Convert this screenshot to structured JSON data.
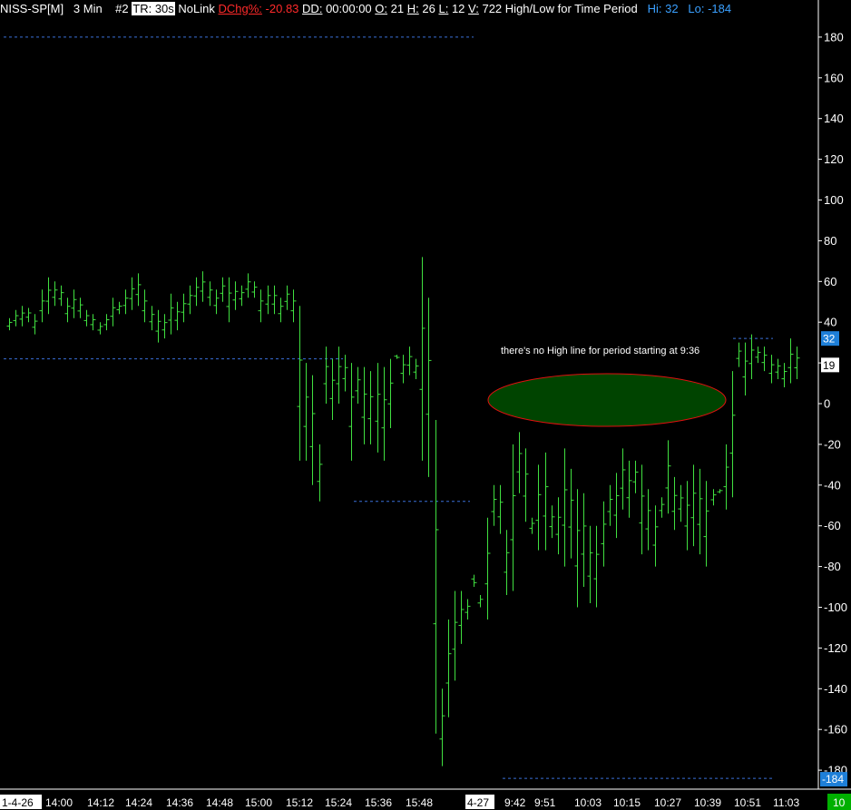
{
  "header": {
    "symbol": "NISS-SP[M]",
    "interval": "3 Min",
    "chart_number": "#2",
    "tr_label": "TR: 30s",
    "link_status": "NoLink",
    "dchg_label": "DChg%:",
    "dchg_value": "-20.83",
    "dd_label": "DD:",
    "dd_value": "00:00:00",
    "o_label": "O:",
    "o_value": "21",
    "h_label": "H:",
    "h_value": "26",
    "l_label": "L:",
    "l_value": "12",
    "v_label": "V:",
    "v_value": "722",
    "study_name": "High/Low for Time Period",
    "hi_text": "Hi: 32",
    "lo_text": "Lo: -184"
  },
  "colors": {
    "background": "#000000",
    "bars": "#40e040",
    "hl_lines": "#3a6fd8",
    "ellipse_fill": "#004400",
    "ellipse_stroke": "#e01010",
    "axis_text": "#ffffff",
    "blue_label_bg": "#1e7fd8",
    "last_price_bg": "#00b000"
  },
  "chart_data": {
    "type": "ohlc",
    "title": "",
    "annotation": "there's no High line for period starting at 9:36",
    "ylim": [
      -190,
      192
    ],
    "y_ticks": [
      180,
      160,
      140,
      120,
      100,
      80,
      60,
      40,
      20,
      0,
      -20,
      -40,
      -60,
      -80,
      -100,
      -120,
      -140,
      -160,
      -180
    ],
    "price_labels": {
      "high": "32",
      "last": "19",
      "low": "-184"
    },
    "x_labels": [
      "1-4-26",
      "14:00",
      "14:12",
      "14:24",
      "14:36",
      "14:48",
      "15:00",
      "15:12",
      "15:24",
      "15:36",
      "15:48",
      "4-27",
      "9:42",
      "9:51",
      "10:03",
      "10:15",
      "10:27",
      "10:39",
      "10:51",
      "11:03"
    ],
    "last_time_label": "10",
    "session_high_low_lines": [
      {
        "session": "1-4-26",
        "high": 180,
        "low": 22
      },
      {
        "session": "1-4-26 close",
        "low": -48
      },
      {
        "session": "4-27",
        "high": 32,
        "low": -184
      }
    ],
    "bars": [
      [
        42,
        36
      ],
      [
        46,
        38
      ],
      [
        48,
        38
      ],
      [
        47,
        40
      ],
      [
        44,
        34
      ],
      [
        56,
        40
      ],
      [
        62,
        44
      ],
      [
        60,
        48
      ],
      [
        58,
        48
      ],
      [
        52,
        40
      ],
      [
        56,
        42
      ],
      [
        52,
        42
      ],
      [
        46,
        38
      ],
      [
        44,
        36
      ],
      [
        40,
        34
      ],
      [
        44,
        36
      ],
      [
        52,
        38
      ],
      [
        50,
        44
      ],
      [
        56,
        44
      ],
      [
        62,
        46
      ],
      [
        64,
        48
      ],
      [
        56,
        40
      ],
      [
        48,
        36
      ],
      [
        46,
        30
      ],
      [
        44,
        32
      ],
      [
        54,
        34
      ],
      [
        50,
        36
      ],
      [
        54,
        40
      ],
      [
        58,
        44
      ],
      [
        62,
        48
      ],
      [
        65,
        50
      ],
      [
        60,
        48
      ],
      [
        56,
        44
      ],
      [
        62,
        50
      ],
      [
        62,
        40
      ],
      [
        60,
        46
      ],
      [
        58,
        48
      ],
      [
        64,
        52
      ],
      [
        60,
        52
      ],
      [
        56,
        40
      ],
      [
        58,
        44
      ],
      [
        58,
        44
      ],
      [
        52,
        40
      ],
      [
        58,
        46
      ],
      [
        56,
        40
      ],
      [
        48,
        -28
      ],
      [
        20,
        -28
      ],
      [
        14,
        -40
      ],
      [
        -20,
        -48
      ],
      [
        28,
        0
      ],
      [
        22,
        -8
      ],
      [
        28,
        0
      ],
      [
        24,
        6
      ],
      [
        20,
        -28
      ],
      [
        18,
        0
      ],
      [
        18,
        -20
      ],
      [
        16,
        -20
      ],
      [
        20,
        -24
      ],
      [
        18,
        -28
      ],
      [
        22,
        -12
      ],
      [
        22,
        24
      ],
      [
        24,
        10
      ],
      [
        28,
        14
      ],
      [
        22,
        12
      ],
      [
        72,
        -28
      ],
      [
        52,
        -36
      ],
      [
        -8,
        -162
      ],
      [
        -140,
        -178
      ],
      [
        -106,
        -154
      ],
      [
        -92,
        -136
      ],
      [
        -92,
        -118
      ],
      [
        -96,
        -106
      ],
      [
        -90,
        -84
      ],
      [
        -94,
        -100
      ],
      [
        -56,
        -106
      ],
      [
        -40,
        -60
      ],
      [
        -40,
        -64
      ],
      [
        -62,
        -94
      ],
      [
        -20,
        -92
      ],
      [
        -14,
        -44
      ],
      [
        -22,
        -58
      ],
      [
        -56,
        -64
      ],
      [
        -30,
        -72
      ],
      [
        -24,
        -72
      ],
      [
        -50,
        -66
      ],
      [
        -46,
        -74
      ],
      [
        -22,
        -80
      ],
      [
        -32,
        -76
      ],
      [
        -42,
        -100
      ],
      [
        -44,
        -90
      ],
      [
        -60,
        -98
      ],
      [
        -60,
        -100
      ],
      [
        -48,
        -80
      ],
      [
        -40,
        -60
      ],
      [
        -34,
        -66
      ],
      [
        -22,
        -52
      ],
      [
        -28,
        -56
      ],
      [
        -28,
        -44
      ],
      [
        -30,
        -74
      ],
      [
        -42,
        -72
      ],
      [
        -50,
        -80
      ],
      [
        -46,
        -56
      ],
      [
        -18,
        -54
      ],
      [
        -36,
        -62
      ],
      [
        -40,
        -58
      ],
      [
        -38,
        -72
      ],
      [
        -30,
        -70
      ],
      [
        -32,
        -74
      ],
      [
        -38,
        -80
      ],
      [
        -42,
        -50
      ],
      [
        -42,
        -44
      ],
      [
        -20,
        -52
      ],
      [
        16,
        -46
      ],
      [
        30,
        18
      ],
      [
        30,
        4
      ],
      [
        34,
        12
      ],
      [
        28,
        20
      ],
      [
        28,
        16
      ],
      [
        24,
        10
      ],
      [
        22,
        12
      ],
      [
        20,
        8
      ],
      [
        32,
        10
      ],
      [
        28,
        12
      ]
    ]
  }
}
